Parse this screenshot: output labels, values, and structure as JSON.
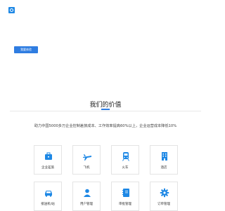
{
  "header": {
    "logo_icon": "brand-logo-icon"
  },
  "hero": {
    "button_label": "我要体验"
  },
  "section": {
    "title": "我们的价值",
    "description": "助力中国5000多万企业控制差旅成本、工作效率提高60%以上，企业运营成本降低10%"
  },
  "features": [
    {
      "label": "企业差旅",
      "icon": "briefcase-icon"
    },
    {
      "label": "飞机",
      "icon": "airplane-icon"
    },
    {
      "label": "火车",
      "icon": "train-icon"
    },
    {
      "label": "酒店",
      "icon": "hotel-icon"
    },
    {
      "label": "接送机/站",
      "icon": "car-icon"
    },
    {
      "label": "用户管理",
      "icon": "user-icon"
    },
    {
      "label": "审批管理",
      "icon": "notebook-icon"
    },
    {
      "label": "订单管理",
      "icon": "gear-icon"
    }
  ],
  "colors": {
    "accent": "#2f7de1",
    "icon": "#1e88e5"
  }
}
